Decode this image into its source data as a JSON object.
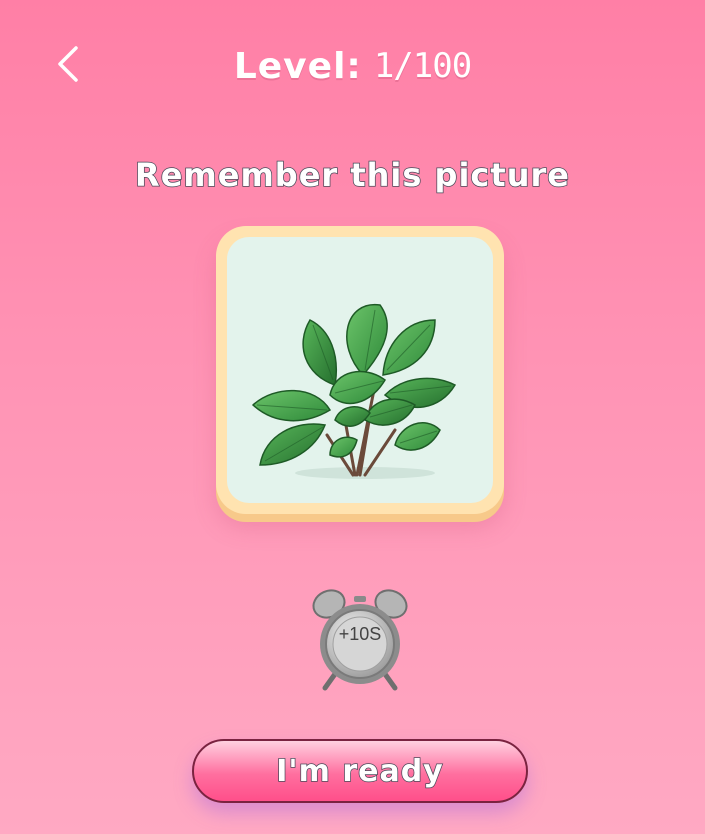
{
  "header": {
    "back_icon": "chevron-left-icon",
    "level_label": "Level:",
    "level_value": "1/100"
  },
  "prompt": "Remember this picture",
  "card": {
    "image_icon": "basil-plant-illustration"
  },
  "timer": {
    "icon": "alarm-clock-icon",
    "label": "+10S"
  },
  "ready_button": {
    "label": "I'm ready"
  },
  "colors": {
    "background_top": "#ff7fa6",
    "background_bottom": "#ffa9c3",
    "card_frame": "#ffe3b0",
    "card_bg": "#e3f3ec",
    "button": "#ff6f9f"
  }
}
